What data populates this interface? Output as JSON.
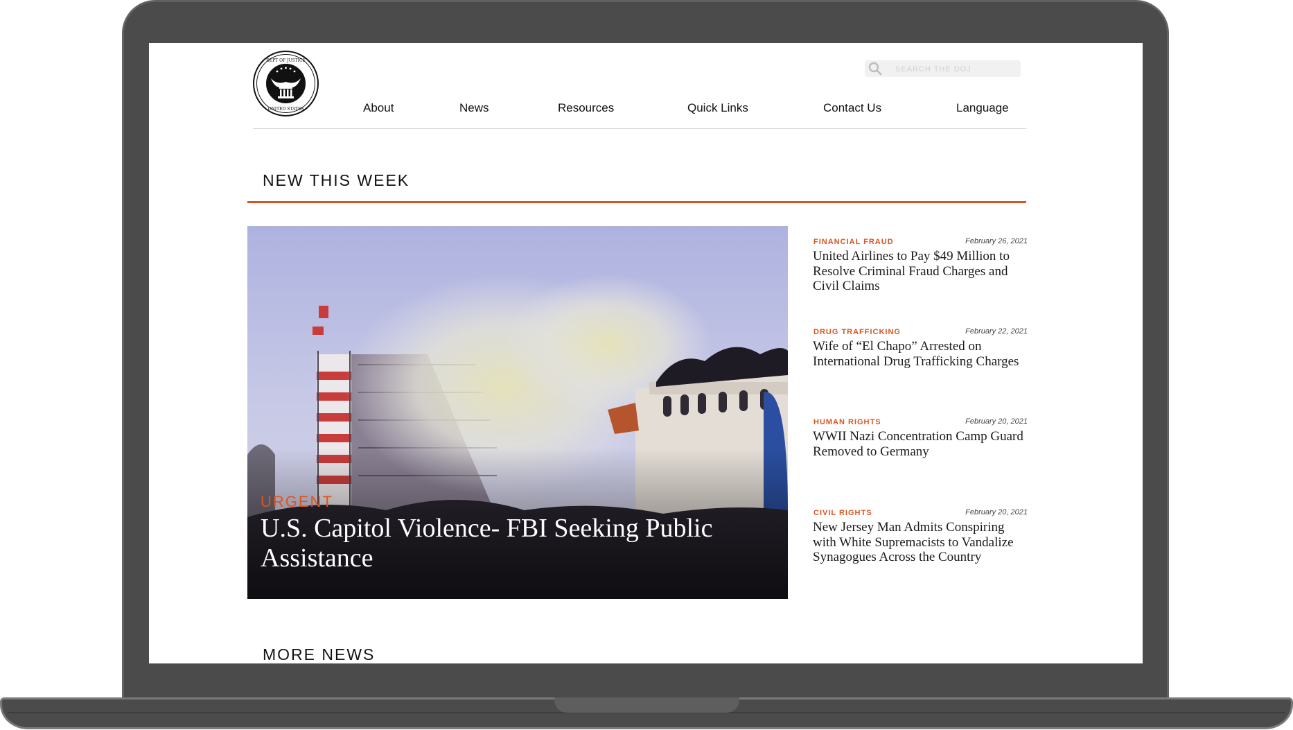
{
  "header": {
    "logo_text": "DEPARTMENT OF JUSTICE · UNITED STATES",
    "search_placeholder": "SEARCH THE DOJ",
    "nav": [
      "About",
      "News",
      "Resources",
      "Quick Links",
      "Contact Us",
      "Language"
    ]
  },
  "sections": {
    "new_this_week": "NEW THIS WEEK",
    "more_news": "MORE NEWS"
  },
  "hero": {
    "tag": "URGENT",
    "title": "U.S. Capitol Violence- FBI Seeking Public Assistance"
  },
  "news": [
    {
      "category": "FINANCIAL FRAUD",
      "date": "February 26, 2021",
      "headline": "United Airlines to Pay $49 Million to Resolve Criminal Fraud Charges and Civil Claims"
    },
    {
      "category": "DRUG TRAFFICKING",
      "date": "February 22, 2021",
      "headline": "Wife of “El Chapo” Arrested on International Drug Trafficking Charges"
    },
    {
      "category": "HUMAN RIGHTS",
      "date": "February 20, 2021",
      "headline": "WWII Nazi Concentration Camp Guard Removed to Germany"
    },
    {
      "category": "CIVIL RIGHTS",
      "date": "February 20, 2021",
      "headline": "New Jersey Man Admits Conspiring with White Supremacists to Vandalize Synagogues Across the Country"
    }
  ],
  "colors": {
    "accent": "#d9541e",
    "frame": "#4b4b4b"
  }
}
